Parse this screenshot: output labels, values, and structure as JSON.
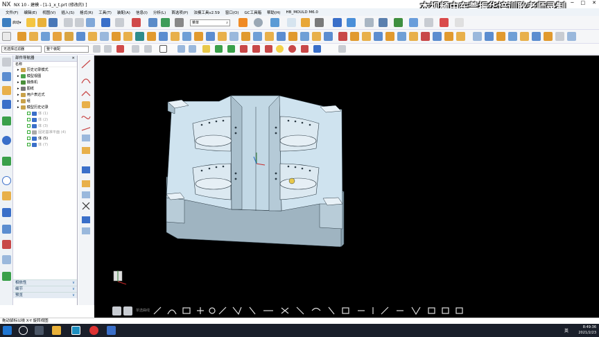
{
  "window": {
    "logo": "NX",
    "title": "NX 10 - 建模 - [1-1_x_t.prt  (修改的) ]",
    "watermark": "本视频由东莞振华培训耿老师录制"
  },
  "menu": {
    "items": [
      "文件(F)",
      "编辑(E)",
      "视图(V)",
      "插入(S)",
      "格式(R)",
      "工具(T)",
      "装配(A)",
      "信息(I)",
      "分析(L)",
      "首选项(P)",
      "法模工具v2.59",
      "窗口(O)",
      "GC工具箱",
      "帮助(H)",
      "HB_MOULD M6.0"
    ],
    "brand": "SIEMENS"
  },
  "toolbar": {
    "start_label": "启动▾",
    "search_value": "菜单"
  },
  "filters": {
    "selection_filter": "无选择过滤器",
    "assembly_scope": "整个装配"
  },
  "navigator": {
    "title": "部件导航器",
    "column": "名称",
    "items": [
      {
        "label": "历史记录模式",
        "indent": 1,
        "color": "#c9a24a",
        "checked": false,
        "gray": false
      },
      {
        "label": "模型视图",
        "indent": 1,
        "color": "#4aa34a",
        "checked": false,
        "gray": false
      },
      {
        "label": "摄像机",
        "indent": 1,
        "color": "#4a8f3a",
        "checked": false,
        "gray": false
      },
      {
        "label": "图纸",
        "indent": 1,
        "color": "#777777",
        "checked": false,
        "gray": false
      },
      {
        "label": "用户表达式",
        "indent": 1,
        "color": "#c9a24a",
        "checked": false,
        "gray": false
      },
      {
        "label": "组",
        "indent": 1,
        "color": "#c9a24a",
        "checked": false,
        "gray": false
      },
      {
        "label": "模型历史记录",
        "indent": 1,
        "color": "#c9a24a",
        "checked": false,
        "gray": false
      },
      {
        "label": "体 (1)",
        "indent": 2,
        "color": "#3a6fc9",
        "checked": true,
        "gray": true
      },
      {
        "label": "体 (2)",
        "indent": 2,
        "color": "#3a6fc9",
        "checked": true,
        "gray": true
      },
      {
        "label": "体 (3)",
        "indent": 2,
        "color": "#3a6fc9",
        "checked": true,
        "gray": true
      },
      {
        "label": "固定基准平面 (4)",
        "indent": 2,
        "color": "#aaaaaa",
        "checked": true,
        "gray": true
      },
      {
        "label": "体 (5)",
        "indent": 2,
        "color": "#3a6fc9",
        "checked": true,
        "gray": false
      },
      {
        "label": "体 (7)",
        "indent": 2,
        "color": "#3a6fc9",
        "checked": true,
        "gray": true
      }
    ],
    "panels": [
      "相依性",
      "细节",
      "预览"
    ]
  },
  "bottom_toolbar": {
    "label": "单选曲线"
  },
  "status": {
    "text": "拖动鼠标以绕 X-Y 旋转视图"
  },
  "taskbar": {
    "ime": "英",
    "time": "8:49:36",
    "date": "2021/2/23"
  },
  "colors": {
    "viewport": "#000000",
    "part_top": "#cfe3ef",
    "part_side": "#a9bfcc",
    "accent": "#2b6cb0"
  }
}
